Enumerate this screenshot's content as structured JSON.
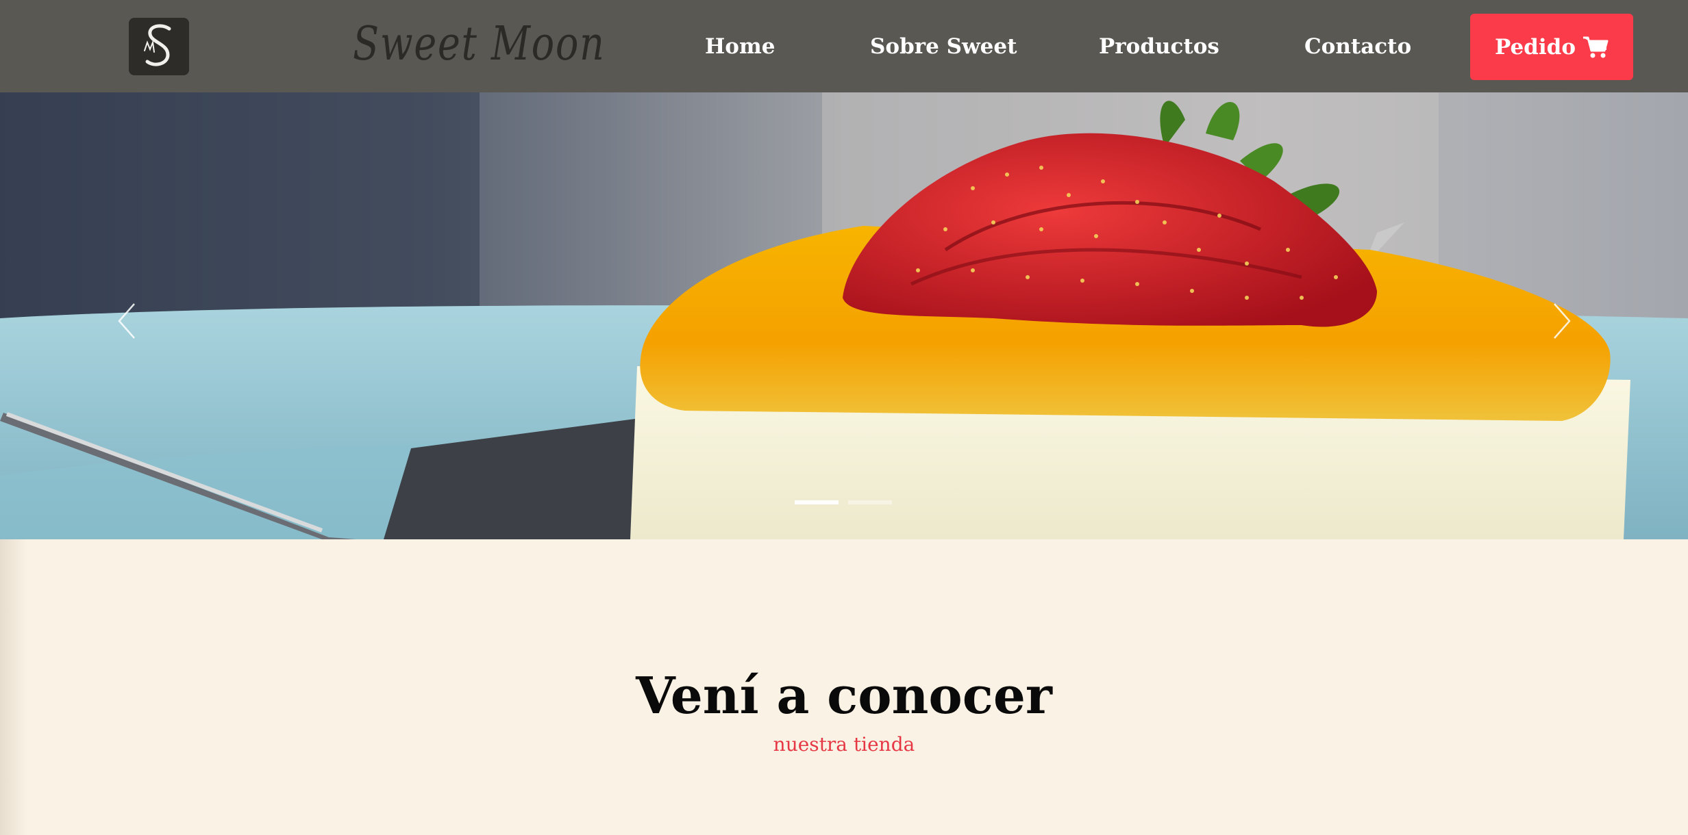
{
  "navbar": {
    "brand": "Sweet Moon",
    "links": {
      "home": "Home",
      "sobre": "Sobre Sweet",
      "productos": "Productos",
      "contacto": "Contacto"
    },
    "order_button": "Pedido",
    "order_icon": "cart-icon",
    "logo_icon": "sweet-moon-logo-icon"
  },
  "hero": {
    "prev_icon": "chevron-left-icon",
    "next_icon": "chevron-right-icon",
    "slide_count": 2,
    "active_slide": 1
  },
  "section": {
    "title": "Vení a conocer",
    "subtitle": "nuestra tienda"
  },
  "colors": {
    "navbar_bg": "#595853",
    "accent": "#fb3b49",
    "page_bg": "#faf2e4",
    "subtitle": "#e63744"
  }
}
